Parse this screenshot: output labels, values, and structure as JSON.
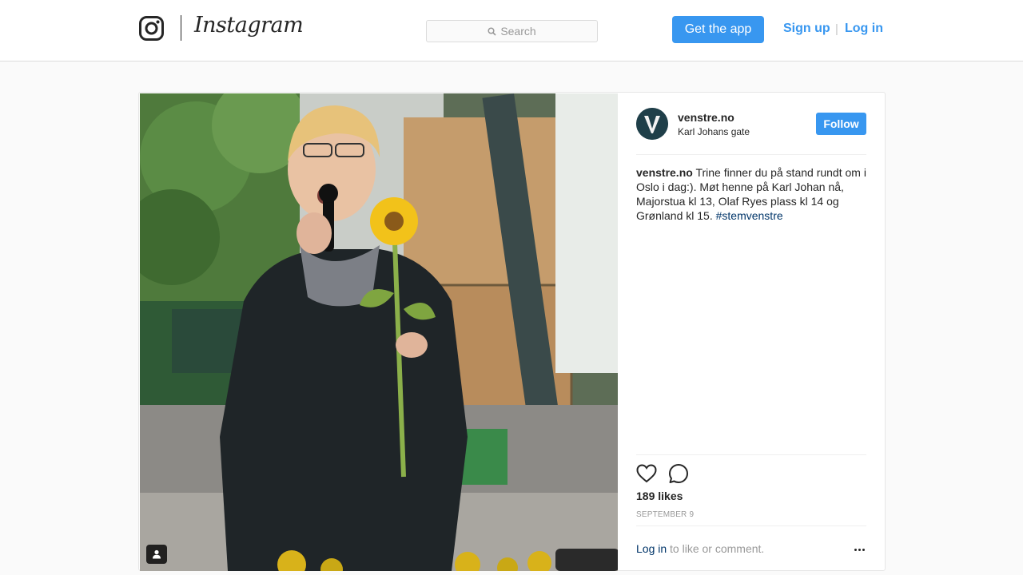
{
  "header": {
    "wordmark": "Instagram",
    "search_placeholder": "Search",
    "get_app_label": "Get the app",
    "signup_label": "Sign up",
    "separator": "|",
    "login_label": "Log in",
    "accent_color": "#3897f0"
  },
  "post": {
    "username": "venstre.no",
    "location": "Karl Johans gate",
    "follow_label": "Follow",
    "caption_username": "venstre.no",
    "caption_text": " Trine finner du på stand rundt om i Oslo i dag:). Møt henne på Karl Johan nå, Majorstua kl 13, Olaf Ryes plass kl 14 og Grønland kl 15. ",
    "hashtag": "#stemvenstre",
    "likes": "189 likes",
    "date": "SEPTEMBER 9",
    "login_prompt_link": "Log in",
    "login_prompt_text": " to like or comment.",
    "icons": {
      "like": "heart-icon",
      "comment": "comment-icon",
      "more": "more-options-icon",
      "tagged": "tagged-user-icon",
      "search": "search-icon"
    }
  }
}
